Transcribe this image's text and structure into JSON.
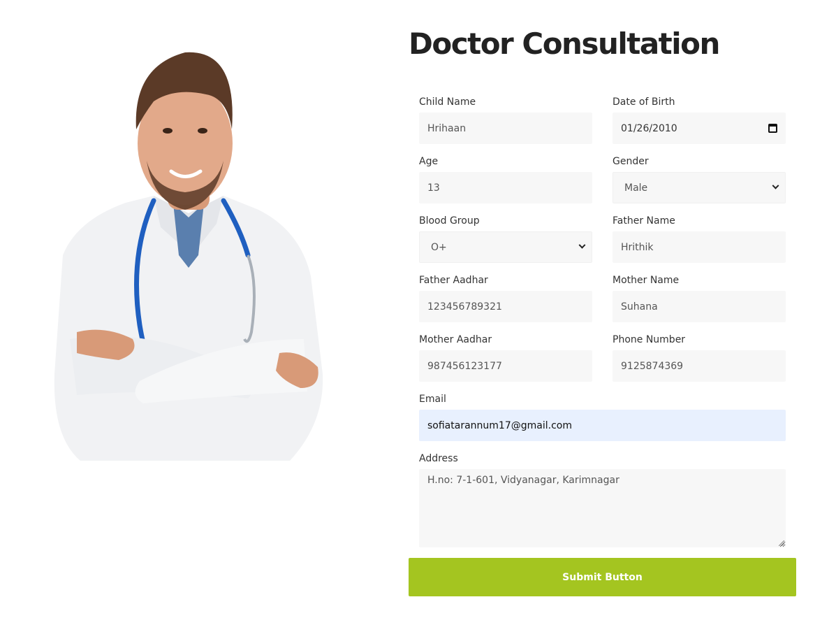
{
  "page": {
    "title": "Doctor Consultation"
  },
  "image": {
    "icon": "doctor-photo"
  },
  "form": {
    "child_name": {
      "label": "Child Name",
      "value": "Hrihaan"
    },
    "date_of_birth": {
      "label": "Date of Birth",
      "value": "01/26/2010",
      "icon": "calendar-icon"
    },
    "age": {
      "label": "Age",
      "value": "13"
    },
    "gender": {
      "label": "Gender",
      "value": "Male"
    },
    "blood_group": {
      "label": "Blood Group",
      "value": "O+"
    },
    "father_name": {
      "label": "Father Name",
      "value": "Hrithik"
    },
    "father_aadhar": {
      "label": "Father Aadhar",
      "value": "123456789321"
    },
    "mother_name": {
      "label": "Mother Name",
      "value": "Suhana"
    },
    "mother_aadhar": {
      "label": "Mother Aadhar",
      "value": "987456123177"
    },
    "phone_number": {
      "label": "Phone Number",
      "value": "9125874369"
    },
    "email": {
      "label": "Email",
      "value": "sofiatarannum17@gmail.com"
    },
    "address": {
      "label": "Address",
      "value": "H.no: 7-1-601, Vidyanagar, Karimnagar"
    },
    "submit_label": "Submit Button"
  },
  "colors": {
    "submit": "#a4c520",
    "field_bg": "#f7f7f7",
    "autofill_bg": "#e8f0fe"
  }
}
